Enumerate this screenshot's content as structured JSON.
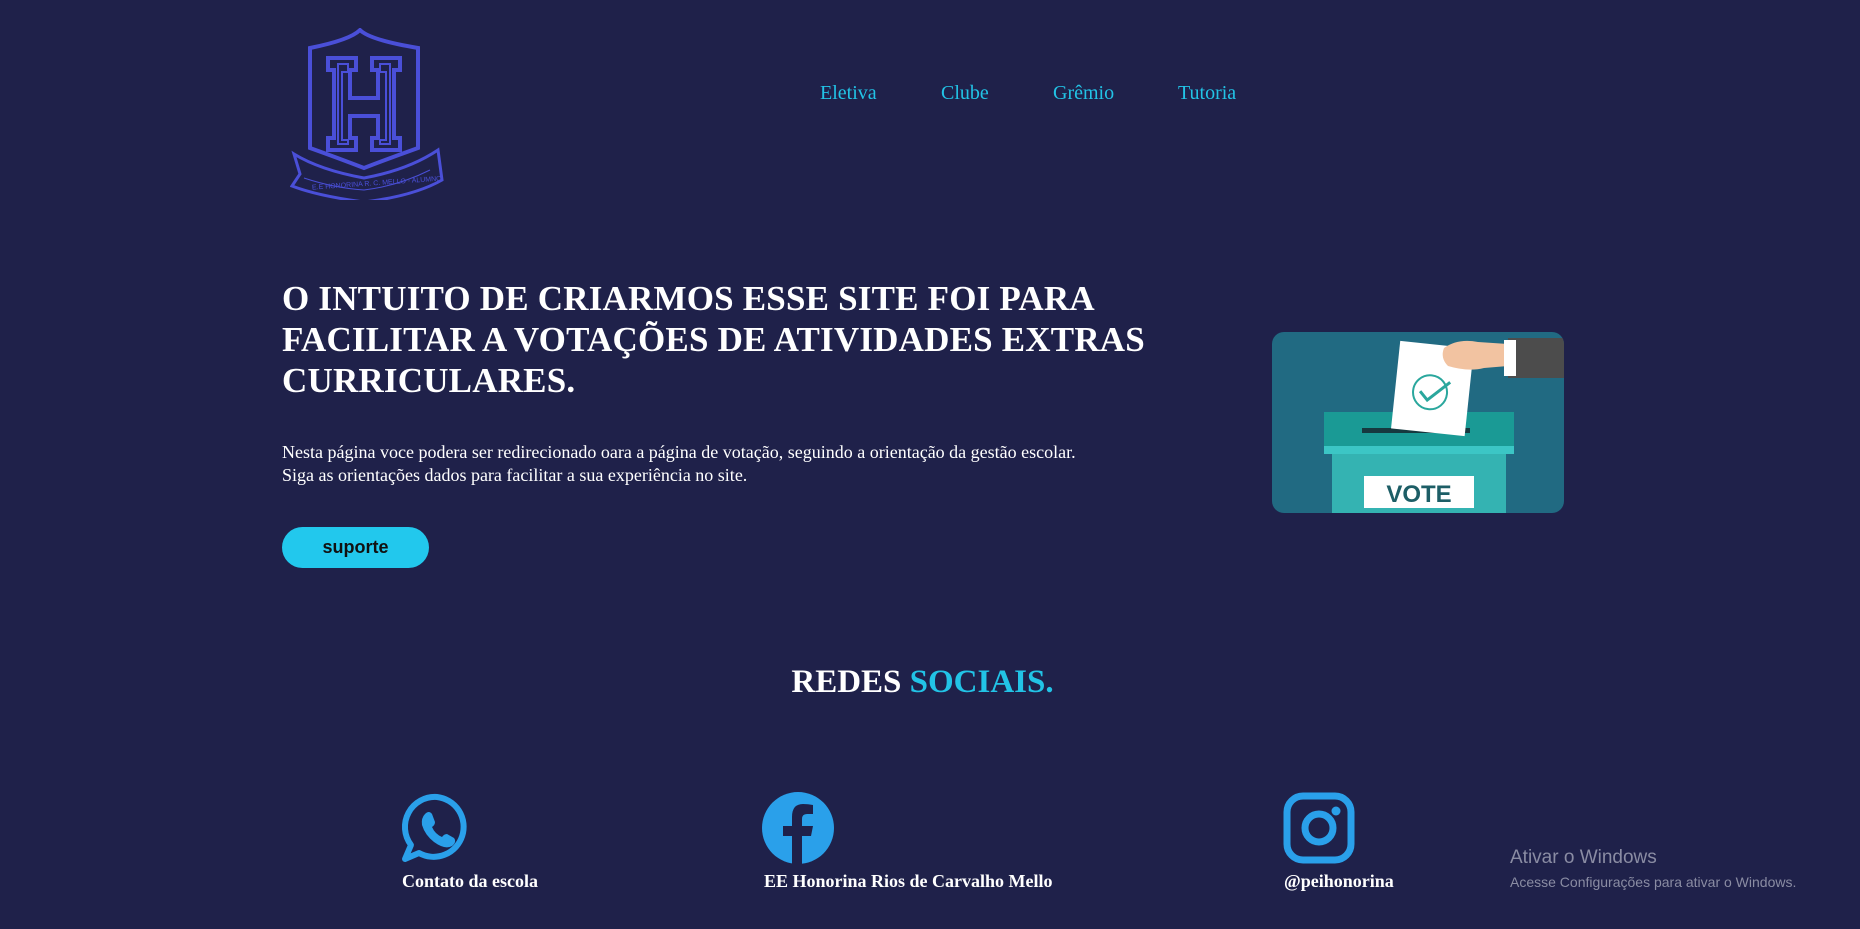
{
  "logo": {
    "letter": "H",
    "ribbon_text": "E.E HONORINA R. C. MELLO - ALUMNO"
  },
  "nav": {
    "items": [
      {
        "label": "Eletiva"
      },
      {
        "label": "Clube"
      },
      {
        "label": "Grêmio"
      },
      {
        "label": "Tutoria"
      }
    ]
  },
  "hero": {
    "title": "O INTUITO DE CRIARMOS ESSE SITE FOI PARA FACILITAR A VOTAÇÕES DE ATIVIDADES EXTRAS CURRICULARES.",
    "description_line1": "Nesta página voce podera ser redirecionado oara a página de votação, seguindo a orientação da gestão escolar.",
    "description_line2": "Siga as orientações dados para facilitar a sua experiência no site.",
    "button_label": "suporte",
    "image_text": "VOTE"
  },
  "social": {
    "title_part1": "REDES",
    "title_part2": "SOCIAIS.",
    "items": [
      {
        "icon": "whatsapp-icon",
        "label": "Contato da escola"
      },
      {
        "icon": "facebook-icon",
        "label": "EE Honorina Rios de Carvalho Mello"
      },
      {
        "icon": "instagram-icon",
        "label": "@peihonorina"
      }
    ]
  },
  "watermark": {
    "title": "Ativar o Windows",
    "subtitle": "Acesse Configurações para ativar o Windows."
  },
  "colors": {
    "background": "#1f214a",
    "accent": "#22c3e6",
    "logo": "#4a4fd8",
    "button": "#22c8ed"
  }
}
